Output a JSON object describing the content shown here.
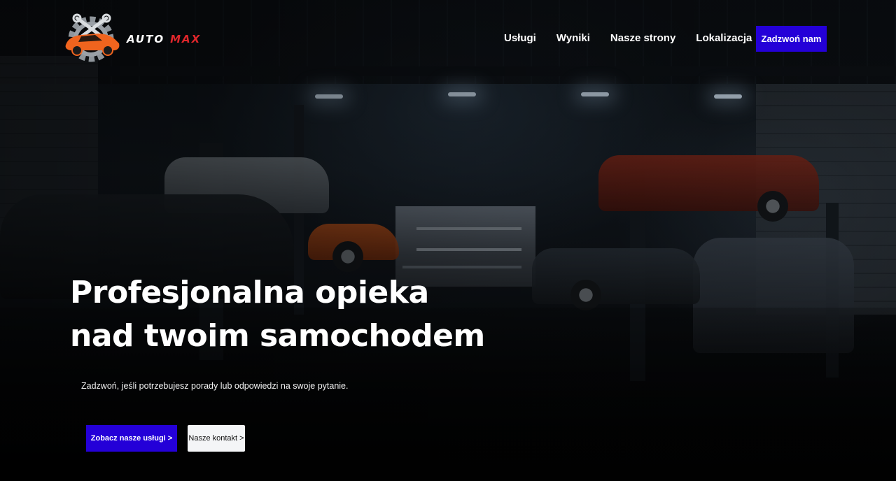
{
  "brand": {
    "logo_word_1": "AUTO",
    "logo_word_2": "MAX",
    "logo_icon": "gear-wrench-car-icon",
    "accent_red": "#e0262b",
    "accent_orange": "#f0641e"
  },
  "nav": {
    "links": [
      "Usługi",
      "Wyniki",
      "Nasze strony",
      "Lokalizacja"
    ],
    "cta_label": "Zadzwoń nam"
  },
  "hero": {
    "title_line_1": "Profesjonalna opieka",
    "title_line_2": "nad twoim samochodem",
    "subtitle": "Zadzwoń, jeśli potrzebujesz porady lub odpowiedzi na swoje pytanie.",
    "primary_button": "Zobacz nasze usługi >",
    "secondary_button": "Nasze kontakt >",
    "background_image": "dark-car-garage-workshop"
  },
  "colors": {
    "primary_button": "#2400d8",
    "secondary_button": "#f4f5f7",
    "text": "#ffffff"
  }
}
